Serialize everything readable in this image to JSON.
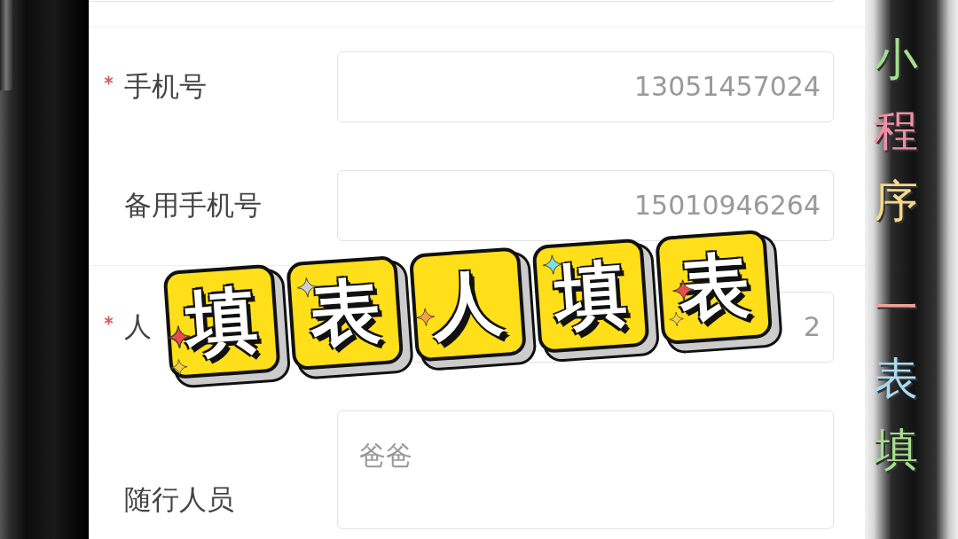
{
  "form": {
    "rows": [
      {
        "label": "手机号",
        "required": true,
        "value": "13051457024",
        "kind": "input"
      },
      {
        "label": "备用手机号",
        "required": false,
        "value": "15010946264",
        "kind": "input"
      },
      {
        "label": "人",
        "required": true,
        "value": "2",
        "kind": "input"
      },
      {
        "label": "随行人员",
        "required": false,
        "value": "爸爸",
        "kind": "textarea"
      }
    ]
  },
  "sticker": {
    "tiles": [
      "填",
      "表",
      "人",
      "填",
      "表"
    ]
  },
  "side_caption": [
    {
      "char": "小",
      "color": "#a6dd8e"
    },
    {
      "char": "程",
      "color": "#ee8fa6"
    },
    {
      "char": "序",
      "color": "#f3d98a"
    },
    {
      "char": "一",
      "color": "#f4a29a"
    },
    {
      "char": "表",
      "color": "#a9d9ee"
    },
    {
      "char": "填",
      "color": "#a6dd8e"
    }
  ]
}
